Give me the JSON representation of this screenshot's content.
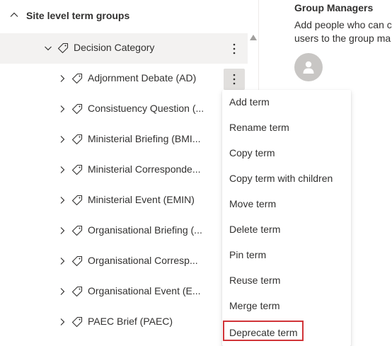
{
  "tree": {
    "group_header": "Site level term groups",
    "term_set": {
      "label": "Decision Category"
    },
    "terms": [
      {
        "label": "Adjornment Debate (AD)"
      },
      {
        "label": "Consistuency Question (..."
      },
      {
        "label": "Ministerial Briefing (BMI..."
      },
      {
        "label": "Ministerial Corresponde..."
      },
      {
        "label": "Ministerial Event (EMIN)"
      },
      {
        "label": "Organisational Briefing (..."
      },
      {
        "label": "Organisational Corresp..."
      },
      {
        "label": "Organisational Event (E..."
      },
      {
        "label": "PAEC Brief (PAEC)"
      }
    ]
  },
  "right_panel": {
    "title": "Group Managers",
    "description_line1": "Add people who can c",
    "description_line2": "users to the group ma"
  },
  "context_menu": {
    "items": [
      {
        "label": "Add term"
      },
      {
        "label": "Rename term"
      },
      {
        "label": "Copy term"
      },
      {
        "label": "Copy term with children"
      },
      {
        "label": "Move term"
      },
      {
        "label": "Delete term"
      },
      {
        "label": "Pin term"
      },
      {
        "label": "Reuse term"
      },
      {
        "label": "Merge term"
      },
      {
        "label": "Deprecate term"
      }
    ],
    "highlighted_item": "Deprecate term",
    "highlight_color": "#d13438"
  },
  "icons": {
    "group_chevron": "chevron-up-icon",
    "term_set_chevron": "chevron-down-icon",
    "term_chevron": "chevron-right-icon",
    "tag": "tag-icon",
    "more": "more-vertical-icon",
    "avatar": "person-icon"
  }
}
